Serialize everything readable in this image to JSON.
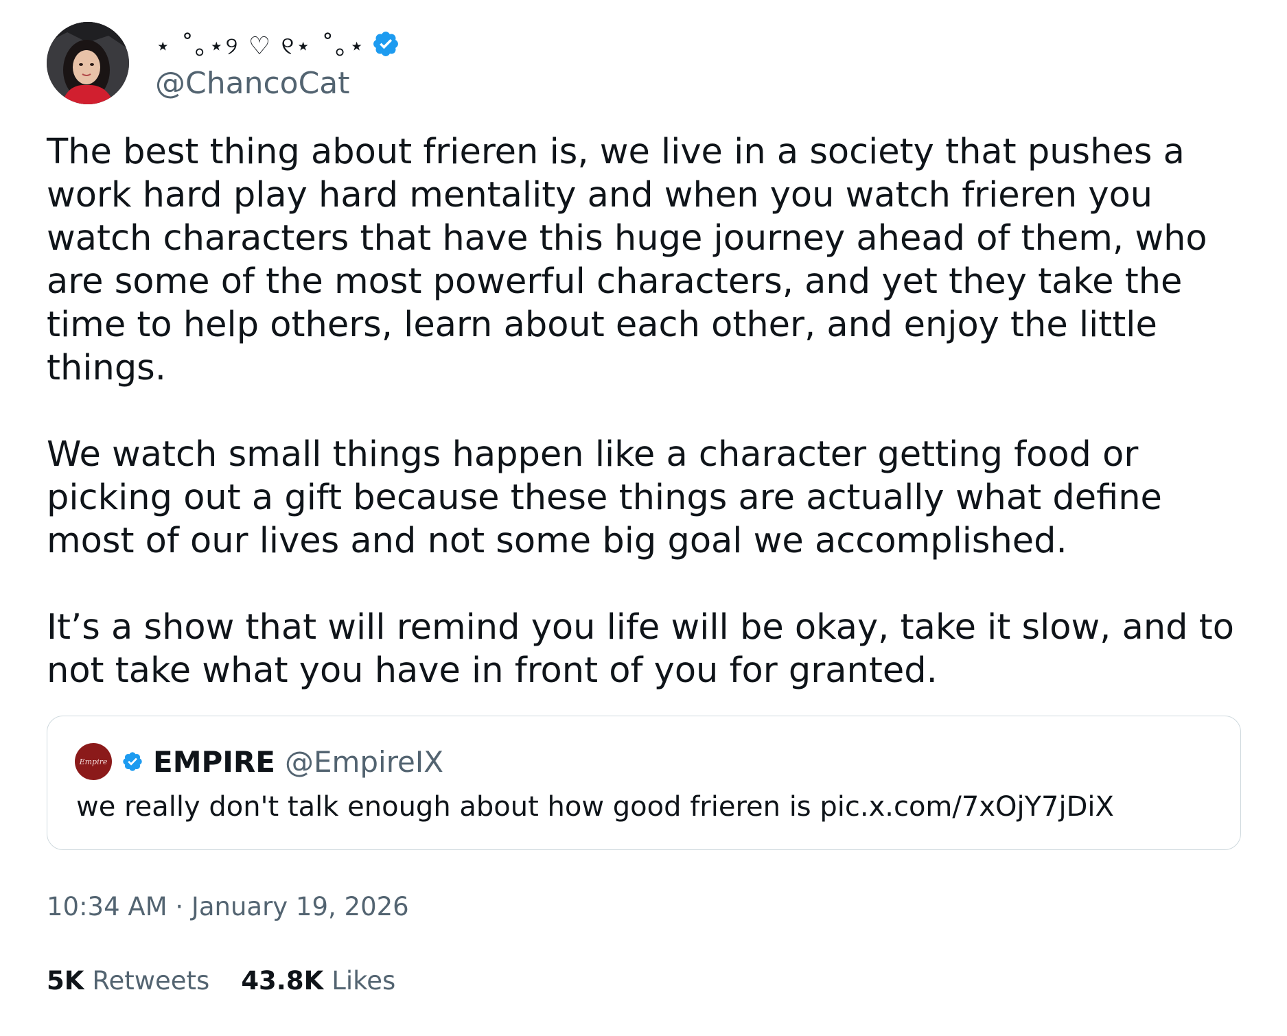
{
  "tweet": {
    "display_name": "⋆ ˚｡⋆୨ ♡ ୧⋆ ˚｡⋆",
    "handle": "@ChancoCat",
    "verified_icon": "verified-badge-icon",
    "paragraphs": [
      "The best thing about frieren is, we live in a society that pushes a work hard play hard mentality and when you watch frieren you watch characters that have this huge journey ahead of them, who are some of the most powerful characters, and yet they take the time to help others, learn about each other, and enjoy the little things.",
      "We watch small things happen like a character getting food or picking out a gift because these things are actually what define most of our lives and not some big goal we accomplished.",
      "It’s a show that will remind you life will be okay, take it slow, and to not take what you have in front of you for granted."
    ],
    "timestamp": "10:34 AM · January 19, 2026",
    "retweets_count": "5K",
    "retweets_label": "Retweets",
    "likes_count": "43.8K",
    "likes_label": "Likes"
  },
  "quote": {
    "avatar_text": "Empire",
    "name": "EMPIRE",
    "handle": "@EmpireIX",
    "text": "we really don't talk enough about how good frieren is pic.x.com/7xOjY7jDiX"
  },
  "colors": {
    "text": "#0f1419",
    "secondary": "#536471",
    "verified": "#1d9bf0",
    "border": "#cfd9de",
    "quote_avatar": "#8b1a1a"
  }
}
